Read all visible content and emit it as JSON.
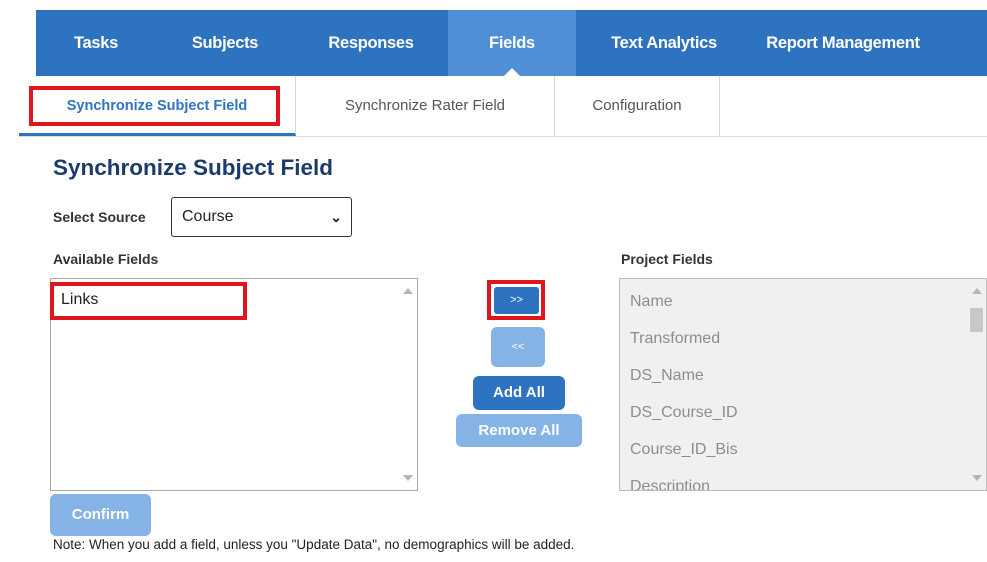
{
  "nav": {
    "tabs": [
      "Tasks",
      "Subjects",
      "Responses",
      "Fields",
      "Text Analytics",
      "Report Management"
    ],
    "active": "Fields"
  },
  "subtabs": [
    "Synchronize Subject Field",
    "Synchronize Rater Field",
    "Configuration"
  ],
  "page_title": "Synchronize Subject Field",
  "source": {
    "label": "Select Source",
    "value": "Course"
  },
  "available": {
    "label": "Available Fields",
    "items": [
      "Links"
    ]
  },
  "project": {
    "label": "Project Fields",
    "items": [
      "Name",
      "Transformed",
      "DS_Name",
      "DS_Course_ID",
      "Course_ID_Bis",
      "Description"
    ]
  },
  "buttons": {
    "add_selected": ">>",
    "remove_selected": "<<",
    "add_all": "Add All",
    "remove_all": "Remove All",
    "confirm": "Confirm"
  },
  "note": "Note: When you add a field, unless you \"Update Data\", no demographics will be added.",
  "colors": {
    "nav_bg": "#2e73c0",
    "nav_active": "#4f8fd6",
    "highlight": "#e0161f",
    "title": "#1d3b6a"
  }
}
